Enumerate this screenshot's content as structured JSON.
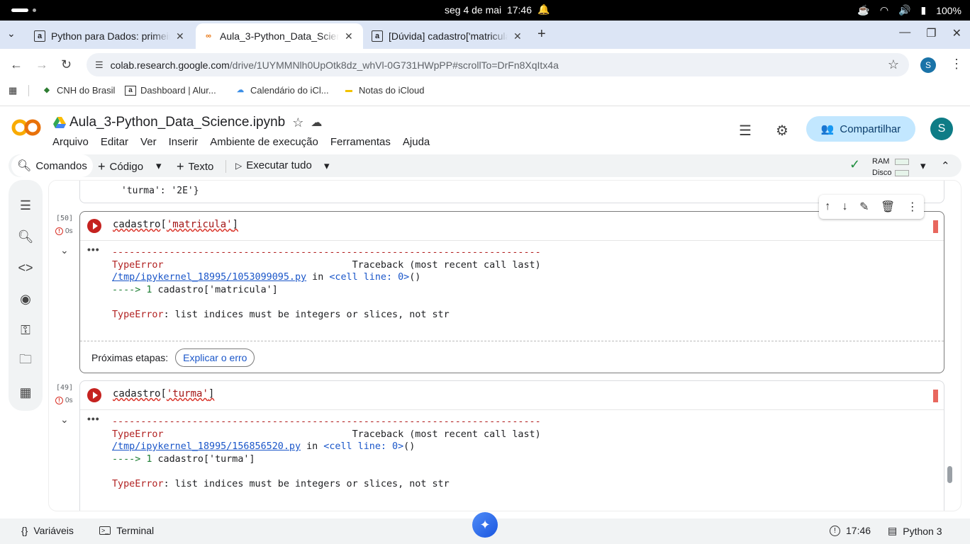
{
  "system": {
    "date": "seg 4 de mai",
    "time": "17:46",
    "battery": "100%"
  },
  "tabs": [
    {
      "title": "Python para Dados: primeiro",
      "favicon": "a",
      "active": false
    },
    {
      "title": "Aula_3-Python_Data_Science",
      "favicon": "CO",
      "active": true
    },
    {
      "title": "[Dúvida] cadastro['matricula'",
      "favicon": "a",
      "active": false
    }
  ],
  "address": {
    "host": "colab.research.google.com",
    "path": "/drive/1UYMMNlh0UpOtk8dz_whVl-0G731HWpPP#scrollTo=DrFn8XqItx4a"
  },
  "profile_initial": "S",
  "bookmarks": [
    {
      "label": "CNH do Brasil"
    },
    {
      "label": "Dashboard | Alur..."
    },
    {
      "label": "Calendário do iCl..."
    },
    {
      "label": "Notas do iCloud"
    }
  ],
  "notebook": {
    "title": "Aula_3-Python_Data_Science.ipynb",
    "menus": [
      "Arquivo",
      "Editar",
      "Ver",
      "Inserir",
      "Ambiente de execução",
      "Ferramentas",
      "Ajuda"
    ],
    "share_label": "Compartilhar",
    "avatar": "S"
  },
  "toolbar": {
    "commands": "Comandos",
    "code": "Código",
    "text": "Texto",
    "run_all": "Executar tudo",
    "ram": "RAM",
    "disk": "Disco"
  },
  "prev_cell_text": "'turma': '2E'}",
  "cells": [
    {
      "exec_count": "[50]",
      "time": "0s",
      "code_var": "cadastro",
      "code_rest": "['matricula']",
      "code_key": "'matricula'",
      "tb_dashes": "---------------------------------------------------------------------------",
      "tb_type": "TypeError",
      "tb_header": "Traceback (most recent call last)",
      "tb_file": "/tmp/ipykernel_18995/1053099095.py",
      "tb_in": " in ",
      "tb_loc": "<cell line: 0>",
      "tb_paren": "()",
      "tb_arrow": "----> 1 ",
      "tb_line": "cadastro['matricula']",
      "tb_msg": ": list indices must be integers or slices, not str",
      "next_steps_label": "Próximas etapas:",
      "explain_label": "Explicar o erro"
    },
    {
      "exec_count": "[49]",
      "time": "0s",
      "code_var": "cadastro",
      "code_key": "'turma'",
      "tb_dashes": "---------------------------------------------------------------------------",
      "tb_type": "TypeError",
      "tb_header": "Traceback (most recent call last)",
      "tb_file": "/tmp/ipykernel_18995/156856520.py",
      "tb_in": " in ",
      "tb_loc": "<cell line: 0>",
      "tb_paren": "()",
      "tb_arrow": "----> 1 ",
      "tb_line": "cadastro['turma']",
      "tb_msg": ": list indices must be integers or slices, not str"
    }
  ],
  "statusbar": {
    "variables": "Variáveis",
    "terminal": "Terminal",
    "time": "17:46",
    "runtime": "Python 3"
  }
}
